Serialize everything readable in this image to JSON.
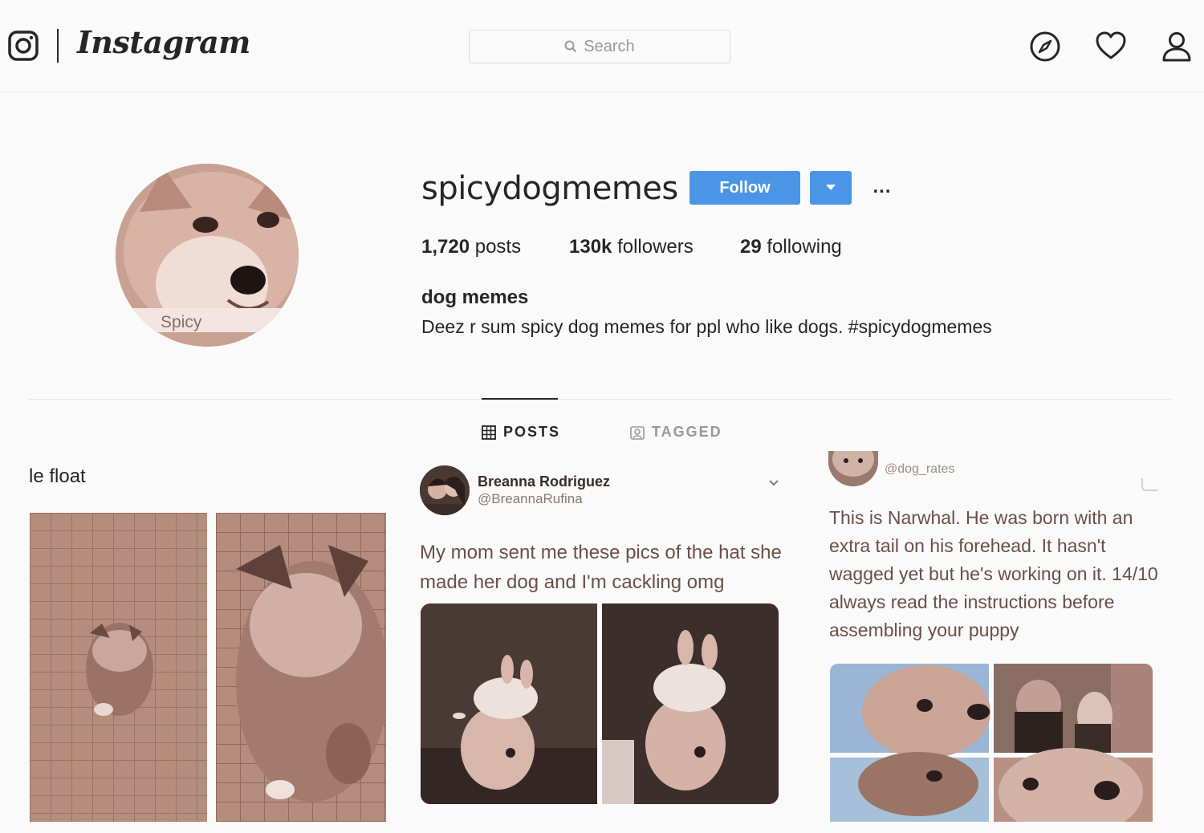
{
  "nav": {
    "brand": "Instagram",
    "search_placeholder": "Search",
    "icons": [
      "instagram-glyph-icon",
      "compass-icon",
      "heart-icon",
      "person-icon",
      "search-icon"
    ]
  },
  "profile": {
    "avatar_label": "Spicy",
    "username": "spicydogmemes",
    "follow_label": "Follow",
    "more_label": "...",
    "stats": {
      "posts_count": "1,720",
      "posts_label": "posts",
      "followers_count": "130k",
      "followers_label": "followers",
      "following_count": "29",
      "following_label": "following"
    },
    "bio_name": "dog memes",
    "bio_text": "Deez r sum spicy dog memes for ppl who like dogs. #spicydogmemes"
  },
  "tabs": {
    "posts_label": "POSTS",
    "tagged_label": "TAGGED",
    "active": "POSTS"
  },
  "posts": [
    {
      "caption_partial": "le float"
    },
    {
      "author_name": "Breanna Rodriguez",
      "author_handle": "@BreannaRufina",
      "text": "My mom sent me these pics of the hat she made her dog and I'm cackling omg"
    },
    {
      "author_handle": "@dog_rates",
      "text": "This is Narwhal. He was born with an extra tail on his forehead. It hasn't wagged yet but he's working on it. 14/10 always read the instructions before assembling your puppy"
    }
  ],
  "colors": {
    "follow_blue": "#4a95e6",
    "text_dark": "#262626",
    "text_muted": "#999999",
    "photo_tint": "#b08878"
  }
}
